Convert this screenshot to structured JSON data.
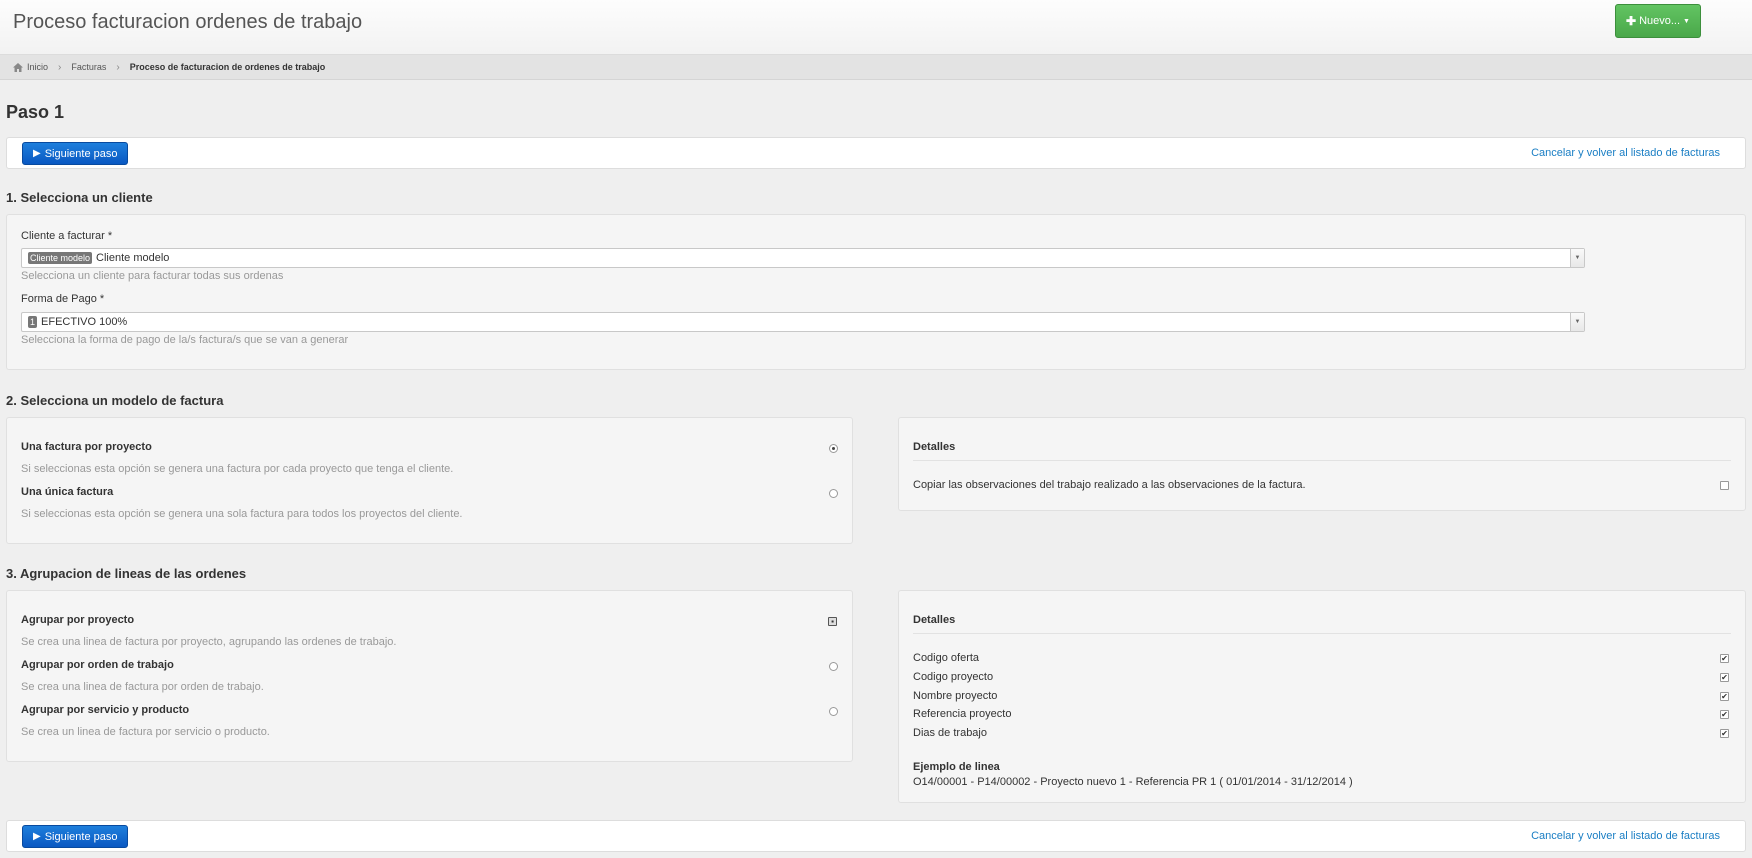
{
  "header": {
    "title": "Proceso facturacion ordenes de trabajo",
    "new_button": "Nuevo..."
  },
  "breadcrumb": {
    "home": "Inicio",
    "invoices": "Facturas",
    "current": "Proceso de facturacion de ordenes de trabajo"
  },
  "step": {
    "title": "Paso 1"
  },
  "actions": {
    "next_label": "Siguiente paso",
    "cancel_label": "Cancelar y volver al listado de facturas"
  },
  "section1": {
    "title": "1. Selecciona un cliente",
    "client": {
      "label": "Cliente a facturar *",
      "tag": "Cliente modelo",
      "value": "Cliente modelo",
      "help": "Selecciona un cliente para facturar todas sus ordenas"
    },
    "payment": {
      "label": "Forma de Pago *",
      "tag": "1",
      "value": "EFECTIVO 100%",
      "help": "Selecciona la forma de pago de la/s factura/s que se van a generar"
    }
  },
  "section2": {
    "title": "2. Selecciona un modelo de factura",
    "options": [
      {
        "label": "Una factura por proyecto",
        "help": "Si seleccionas esta opción se genera una factura por cada proyecto que tenga el cliente.",
        "selected": true
      },
      {
        "label": "Una única factura",
        "help": "Si seleccionas esta opción se genera una sola factura para todos los proyectos del cliente.",
        "selected": false
      }
    ],
    "details": {
      "title": "Detalles",
      "copy_observations": "Copiar las observaciones del trabajo realizado a las observaciones de la factura.",
      "copy_checked": false
    }
  },
  "section3": {
    "title": "3. Agrupacion de lineas de las ordenes",
    "options": [
      {
        "label": "Agrupar por proyecto",
        "help": "Se crea una linea de factura por proyecto, agrupando las ordenes de trabajo.",
        "selected": true
      },
      {
        "label": "Agrupar por orden de trabajo",
        "help": "Se crea una linea de factura por orden de trabajo.",
        "selected": false
      },
      {
        "label": "Agrupar por servicio y producto",
        "help": "Se crea un linea de factura por servicio o producto.",
        "selected": false
      }
    ],
    "details": {
      "title": "Detalles",
      "fields": [
        {
          "label": "Codigo oferta",
          "checked": true
        },
        {
          "label": "Codigo proyecto",
          "checked": true
        },
        {
          "label": "Nombre proyecto",
          "checked": true
        },
        {
          "label": "Referencia proyecto",
          "checked": true
        },
        {
          "label": "Dias de trabajo",
          "checked": true
        }
      ],
      "example_title": "Ejemplo de linea",
      "example_value": "O14/00001 - P14/00002 - Proyecto nuevo 1 - Referencia PR 1 ( 01/01/2014 - 31/12/2014 )"
    }
  },
  "colors": {
    "primary": "#0a58c2",
    "success": "#4aa84a",
    "link": "#1a7ec4"
  }
}
